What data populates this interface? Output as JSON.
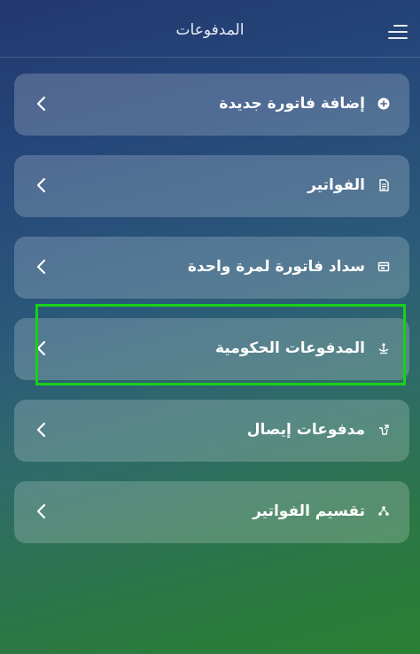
{
  "header": {
    "title": "المدفوعات",
    "menu_icon": "hamburger-menu-icon"
  },
  "items": [
    {
      "label": "إضافة فاتورة جديدة",
      "icon": "plus-circle-icon"
    },
    {
      "label": "الفواتير",
      "icon": "document-icon"
    },
    {
      "label": "سداد فاتورة لمرة واحدة",
      "icon": "card-icon"
    },
    {
      "label": "المدفوعات الحكومية",
      "icon": "government-icon"
    },
    {
      "label": "مدفوعات إيصال",
      "icon": "receipt-icon"
    },
    {
      "label": "تقسيم الفواتير",
      "icon": "split-icon"
    }
  ],
  "colors": {
    "highlight": "#19d019",
    "card": "rgba(255,255,255,0.20)"
  }
}
